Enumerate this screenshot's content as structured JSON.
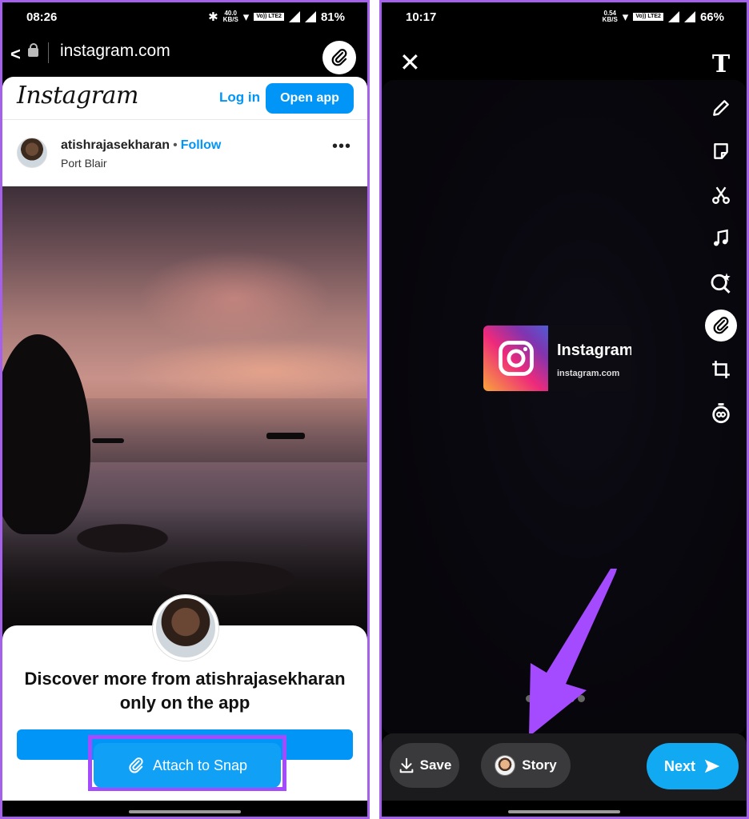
{
  "left_screen": {
    "status": {
      "time": "08:26",
      "net_speed_top": "40.0",
      "net_speed_unit": "KB/S",
      "volte": "Vo)) LTE2",
      "battery": "81%"
    },
    "url_bar": {
      "url": "instagram.com"
    },
    "instagram_header": {
      "logo": "Instagram",
      "login_label": "Log in",
      "open_app_label": "Open app"
    },
    "post": {
      "username": "atishrajasekharan",
      "separator": "•",
      "follow_label": "Follow",
      "location": "Port Blair",
      "more": "•••"
    },
    "sheet": {
      "headline": "Discover more from atishrajasekharan only on the app",
      "attach_label": "Attach to Snap"
    },
    "colors": {
      "accent": "#0095f6",
      "highlight": "#a54bff"
    }
  },
  "right_screen": {
    "status": {
      "time": "10:17",
      "net_speed_top": "0.54",
      "net_speed_unit": "KB/S",
      "volte": "Vo)) LTE2",
      "battery": "66%"
    },
    "tools": [
      "text-tool",
      "pen-tool",
      "sticker-tool",
      "scissors-tool",
      "music-tool",
      "lens-tool",
      "attach-tool",
      "crop-tool",
      "timer-tool"
    ],
    "text_tool_glyph": "T",
    "link_card": {
      "title": "Instagram",
      "domain": "instagram.com"
    },
    "bottom": {
      "save_label": "Save",
      "story_label": "Story",
      "next_label": "Next"
    },
    "colors": {
      "next": "#10a9f2",
      "arrow": "#a54bff"
    }
  }
}
